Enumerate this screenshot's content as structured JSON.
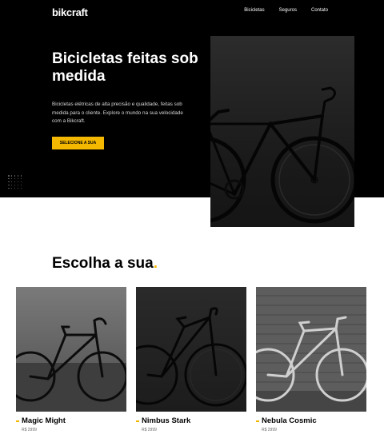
{
  "header": {
    "logo": "bikcraft",
    "nav": [
      "Bicicletas",
      "Seguros",
      "Contato"
    ]
  },
  "hero": {
    "title": "Bicicletas feitas sob medida",
    "text": "Bicicletas elétricas de alta precisão e qualidade, feitas sob medida para o cliente. Explore o mundo na sua velocidade com a Bikcraft.",
    "cta": "SELECIONE A SUA"
  },
  "section": {
    "title": "Escolha a sua",
    "title_dot": "."
  },
  "products": [
    {
      "name": "Magic Might",
      "price": "R$ 2999"
    },
    {
      "name": "Nimbus Stark",
      "price": "R$ 2999"
    },
    {
      "name": "Nebula Cosmic",
      "price": "R$ 2999"
    }
  ],
  "colors": {
    "accent": "#f5b800",
    "hero_bg": "#000000"
  }
}
